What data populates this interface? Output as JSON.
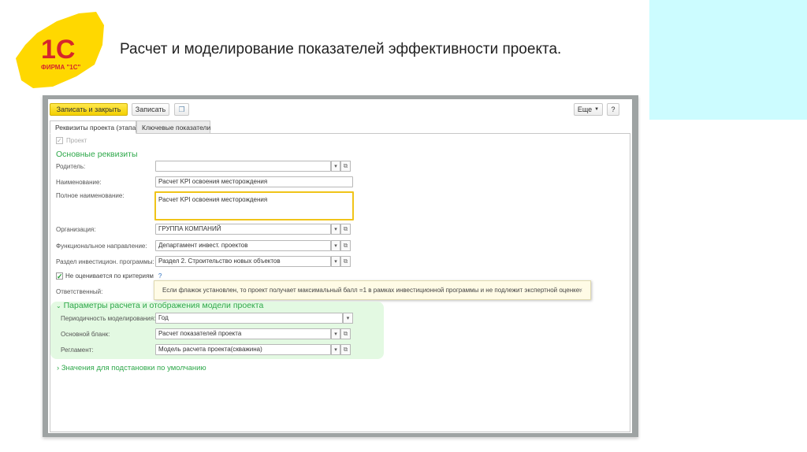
{
  "slide": {
    "title": "Расчет и моделирование показателей эффективности проекта.",
    "logo_text": "1С ФИРМА \"1С\""
  },
  "toolbar": {
    "save_close": "Записать и закрыть",
    "save": "Записать",
    "more": "Еще",
    "help": "?"
  },
  "tabs": [
    {
      "label": "Реквизиты проекта (этапа)"
    },
    {
      "label": "Ключевые показатели"
    }
  ],
  "form": {
    "project_checkbox": "Проект",
    "section_main": "Основные реквизиты",
    "parent": {
      "label": "Родитель:",
      "value": ""
    },
    "name": {
      "label": "Наименование:",
      "value": "Расчет KPI освоения месторождения"
    },
    "full_name": {
      "label": "Полное наименование:",
      "value": "Расчет KPI освоения месторождения"
    },
    "organization": {
      "label": "Организация:",
      "value": "ГРУППА КОМПАНИЙ"
    },
    "direction": {
      "label": "Функциональное направление:",
      "value": "Департамент инвест. проектов"
    },
    "section": {
      "label": "Раздел инвестицион. программы:",
      "value": "Раздел 2. Строительство новых объектов"
    },
    "not_evaluated": {
      "label": "Не оценивается по критериям",
      "help": "?",
      "checked": true
    },
    "responsible": {
      "label": "Ответственный:"
    },
    "tooltip": {
      "text": "Если флажок установлен, то проект получает максимальный балл =1 в рамках инвестиционной программы и не подлежит экспертной оценке.",
      "close": "×"
    },
    "params_group": {
      "title": "Параметры расчета и отображения модели проекта",
      "periodicity": {
        "label": "Периодичность моделирования:",
        "value": "Год"
      },
      "main_form": {
        "label": "Основной бланк:",
        "value": "Расчет показателей проекта"
      },
      "regulation": {
        "label": "Регламент:",
        "value": "Модель расчета проекта(скважина)"
      }
    },
    "defaults_group": {
      "title": "Значения для подстановки по умолчанию"
    }
  }
}
